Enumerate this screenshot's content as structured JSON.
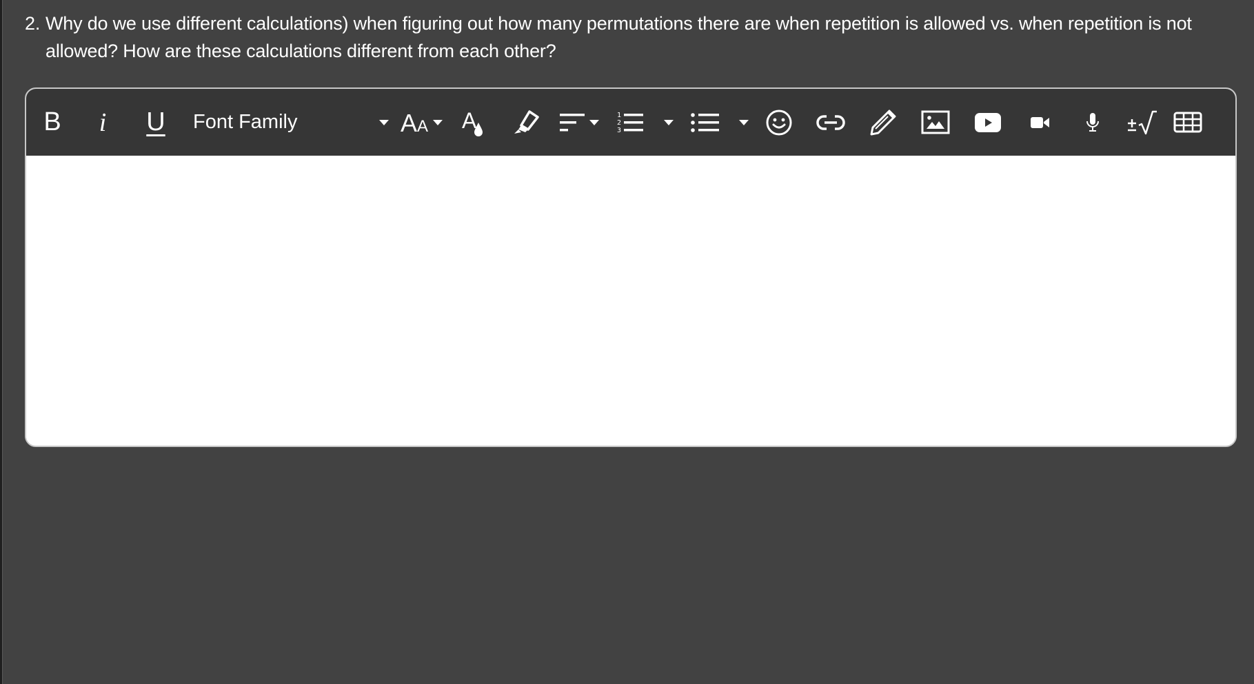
{
  "question": {
    "number": "2.",
    "text": "Why do we use different calculations) when figuring out how many permutations there are when repetition is allowed vs. when repetition is not allowed? How are these calculations different from each other?"
  },
  "editor": {
    "toolbar": {
      "bold_label": "B",
      "italic_label": "i",
      "underline_label": "U",
      "font_family_label": "Font Family",
      "font_size_icon": "font-size-icon",
      "text_color_icon": "text-color-icon",
      "highlight_icon": "highlighter-icon",
      "align_icon": "align-left-icon",
      "ordered_list_icon": "ordered-list-icon",
      "unordered_list_icon": "unordered-list-icon",
      "emoji_icon": "emoji-icon",
      "link_icon": "link-icon",
      "draw_icon": "pencil-icon",
      "image_icon": "image-icon",
      "youtube_icon": "youtube-icon",
      "video_icon": "video-camera-icon",
      "audio_icon": "microphone-icon",
      "math_label": "±√",
      "table_icon": "table-icon"
    },
    "body_value": ""
  },
  "colors": {
    "page_bg": "#424242",
    "toolbar_bg": "#363636",
    "editor_bg": "#ffffff",
    "editor_border": "#c8c8c8",
    "text": "#ffffff"
  }
}
